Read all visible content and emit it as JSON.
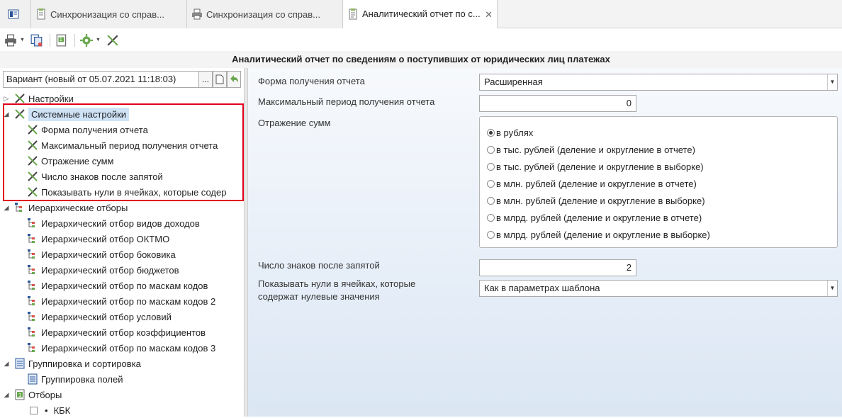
{
  "tabs": [
    {
      "label": "",
      "icon": "home-icon"
    },
    {
      "label": "Синхронизация со справ...",
      "icon": "document-icon"
    },
    {
      "label": "Синхронизация со справ...",
      "icon": "printer-icon"
    },
    {
      "label": "Аналитический отчет по с...",
      "icon": "report-icon",
      "close": "✕"
    }
  ],
  "toolbar": {
    "items": [
      "printer-icon",
      "copy-icon",
      "export-icon",
      "settings-icon",
      "tools-icon"
    ]
  },
  "title": "Аналитический отчет по сведениям о поступивших от юридических лиц платежах",
  "variant": {
    "value": "Вариант (новый от 05.07.2021 11:18:03)",
    "ellipsis": "..."
  },
  "tree": [
    {
      "label": "Настройки",
      "level": 0,
      "expander": "▷",
      "icon": "tools-icon"
    },
    {
      "label": "Системные настройки",
      "level": 0,
      "expander": "◢",
      "icon": "tools-icon",
      "selected": true
    },
    {
      "label": "Форма получения отчета",
      "level": 1,
      "icon": "tools-icon"
    },
    {
      "label": "Максимальный период получения отчета",
      "level": 1,
      "icon": "tools-icon"
    },
    {
      "label": "Отражение сумм",
      "level": 1,
      "icon": "tools-icon"
    },
    {
      "label": "Число знаков после запятой",
      "level": 1,
      "icon": "tools-icon"
    },
    {
      "label": "Показывать нули в ячейках, которые содер",
      "level": 1,
      "icon": "tools-icon"
    },
    {
      "label": "Иерархические отборы",
      "level": 0,
      "expander": "◢",
      "icon": "hierarchy-icon"
    },
    {
      "label": "Иерархический отбор видов доходов",
      "level": 1,
      "icon": "hierarchy-icon"
    },
    {
      "label": "Иерархический отбор ОКТМО",
      "level": 1,
      "icon": "hierarchy-icon"
    },
    {
      "label": "Иерархический отбор боковика",
      "level": 1,
      "icon": "hierarchy-icon"
    },
    {
      "label": "Иерархический отбор бюджетов",
      "level": 1,
      "icon": "hierarchy-icon"
    },
    {
      "label": "Иерархический отбор по маскам кодов",
      "level": 1,
      "icon": "hierarchy-icon"
    },
    {
      "label": "Иерархический отбор по маскам кодов 2",
      "level": 1,
      "icon": "hierarchy-icon"
    },
    {
      "label": "Иерархический отбор условий",
      "level": 1,
      "icon": "hierarchy-icon"
    },
    {
      "label": "Иерархический отбор коэффициентов",
      "level": 1,
      "icon": "hierarchy-icon"
    },
    {
      "label": "Иерархический отбор по маскам кодов 3",
      "level": 1,
      "icon": "hierarchy-icon"
    },
    {
      "label": "Группировка и сортировка",
      "level": 0,
      "expander": "◢",
      "icon": "grouping-icon"
    },
    {
      "label": "Группировка полей",
      "level": 1,
      "icon": "grouping-icon"
    },
    {
      "label": "Отборы",
      "level": 0,
      "expander": "◢",
      "icon": "filter-icon"
    },
    {
      "label": "КБК",
      "level": 1,
      "icon": "checkbox-icon",
      "bullet": "•"
    }
  ],
  "form": {
    "report_form": {
      "label": "Форма получения отчета",
      "value": "Расширенная"
    },
    "max_period": {
      "label": "Максимальный период получения отчета",
      "value": "0"
    },
    "amounts": {
      "label": "Отражение сумм",
      "options": [
        {
          "label": "в рублях",
          "selected": true
        },
        {
          "label": "в тыс. рублей (деление и округление в отчете)",
          "selected": false
        },
        {
          "label": "в тыс. рублей (деление и округление в выборке)",
          "selected": false
        },
        {
          "label": "в млн. рублей (деление и округление в отчете)",
          "selected": false
        },
        {
          "label": "в млн. рублей (деление и округление в выборке)",
          "selected": false
        },
        {
          "label": "в млрд. рублей (деление и округление в отчете)",
          "selected": false
        },
        {
          "label": "в млрд. рублей (деление и округление в выборке)",
          "selected": false
        }
      ]
    },
    "decimals": {
      "label": "Число знаков после запятой",
      "value": "2"
    },
    "show_zeros": {
      "label_line1": "Показывать нули в ячейках, которые",
      "label_line2": "содержат нулевые значения",
      "value": "Как в параметрах шаблона"
    }
  },
  "colors": {
    "accent": "#2b579a",
    "highlight": "#e0001b",
    "selection": "#cfe3f7"
  }
}
